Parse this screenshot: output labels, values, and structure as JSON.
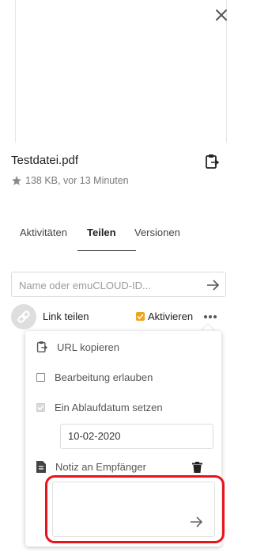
{
  "file": {
    "name": "Testdatei.pdf",
    "meta": "138 KB, vor 13 Minuten"
  },
  "icons": {
    "close": "close-icon",
    "clipboard": "clipboard-icon",
    "star": "star-icon",
    "arrow": "arrow-right-icon",
    "link": "link-icon",
    "more": "more-dots-icon",
    "note": "document-icon",
    "trash": "trash-icon"
  },
  "tabs": [
    {
      "label": "Aktivitäten",
      "active": false
    },
    {
      "label": "Teilen",
      "active": true
    },
    {
      "label": "Versionen",
      "active": false
    }
  ],
  "share": {
    "search_placeholder": "Name oder emuCLOUD-ID...",
    "link_label": "Link teilen",
    "activate_label": "Aktivieren",
    "activated": true
  },
  "menu": {
    "copy_url": "URL kopieren",
    "allow_edit": "Bearbeitung erlauben",
    "allow_edit_checked": false,
    "expiry": "Ein Ablaufdatum setzen",
    "expiry_checked": true,
    "expiry_date": "10-02-2020",
    "note_label": "Notiz an Empfänger",
    "note_value": ""
  },
  "colors": {
    "accent": "#f0a41c",
    "highlight": "#e8141c"
  }
}
